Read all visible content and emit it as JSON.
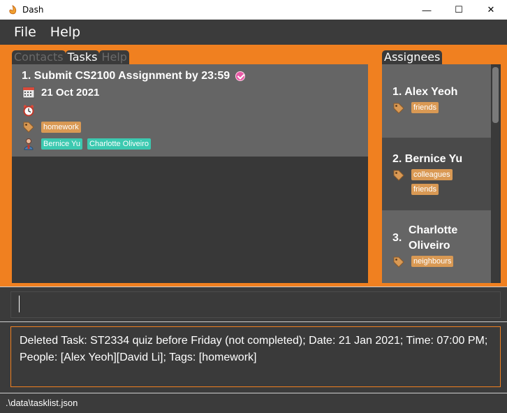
{
  "window": {
    "title": "Dash",
    "minimize": "—",
    "maximize": "☐",
    "close": "✕"
  },
  "menu": {
    "file": "File",
    "help": "Help"
  },
  "tabs": {
    "contacts": "Contacts",
    "tasks": "Tasks",
    "help": "Help"
  },
  "task": {
    "title": "1.  Submit CS2100 Assignment by 23:59",
    "completed": true,
    "date": "21 Oct 2021",
    "tags": [
      "homework"
    ],
    "people": [
      "Bernice Yu",
      "Charlotte Oliveiro"
    ]
  },
  "assignees": {
    "header": "Assignees",
    "items": [
      {
        "name": "1.  Alex Yeoh",
        "tags": [
          "friends"
        ]
      },
      {
        "name": "2.  Bernice Yu",
        "tags": [
          "colleagues",
          "friends"
        ]
      },
      {
        "name_line1": "Charlotte",
        "name_line2": "Oliveiro",
        "index": "3.",
        "tags": [
          "neighbours"
        ]
      }
    ]
  },
  "command": {
    "value": ""
  },
  "result": "Deleted Task: ST2334 quiz before Friday (not completed); Date: 21 Jan 2021; Time: 07:00 PM; People: [Alex Yeoh][David Li]; Tags: [homework]",
  "status": ".\\data\\tasklist.json",
  "colors": {
    "accent": "#f08020",
    "panel": "#3a3a3a",
    "card": "#656565",
    "tag": "#d99954",
    "person": "#3cc9b0"
  }
}
